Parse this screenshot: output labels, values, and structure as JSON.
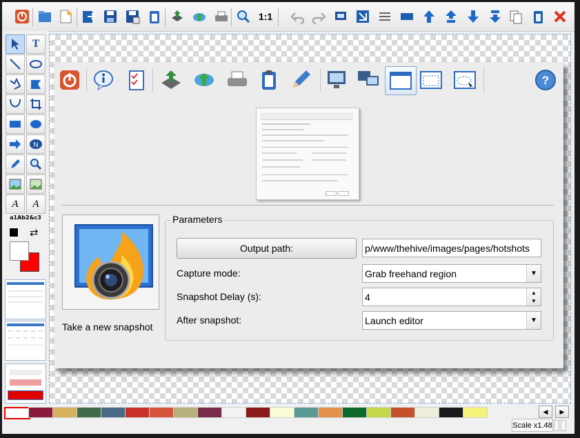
{
  "toolbar": {
    "icons": [
      "exit-icon",
      "open-icon",
      "new-icon",
      "export-icon",
      "save-icon",
      "save-as-icon",
      "clipboard-icon",
      "upload-icon",
      "cloud-upload-icon",
      "print-icon",
      "zoom-icon",
      "actual-size-icon",
      "undo-icon",
      "redo-icon",
      "capture-icon",
      "crop-icon",
      "align-icon",
      "rectangle-icon",
      "bring-to-front-icon",
      "move-up-icon",
      "move-down-icon",
      "send-to-back-icon",
      "copy-icon",
      "paste-icon",
      "close-icon"
    ],
    "actual_size_label": "1:1"
  },
  "tools": {
    "text_sample": "a1Ab2&c3",
    "colors": {
      "foreground": "#ffffff",
      "background": "#ff0000",
      "accent": "#3a78c8"
    }
  },
  "dialog": {
    "icons": [
      "exit-icon",
      "info-icon",
      "checklist-icon",
      "upload-icon",
      "cloud-upload-icon",
      "print-icon",
      "clipboard-icon",
      "pencil-icon",
      "monitor-icon",
      "dual-monitor-icon",
      "window-icon",
      "region-icon",
      "freehand-region-icon",
      "help-icon"
    ],
    "parameters_title": "Parameters",
    "snapshot_label": "Take a new snapshot",
    "output_path_button": "Output path:",
    "output_path_value": "p/www/thehive/images/pages/hotshots",
    "capture_mode_label": "Capture mode:",
    "capture_mode_value": "Grab freehand region",
    "delay_label": "Snapshot Delay (s):",
    "delay_value": "4",
    "after_label": "After snapshot:",
    "after_value": "Launch editor"
  },
  "palette": [
    "#ffffff",
    "#8b1a3a",
    "#d6b05a",
    "#3f6b4a",
    "#4a6a86",
    "#c8302a",
    "#d5543a",
    "#b6b07a",
    "#7a2a4a",
    "#f2f2f2",
    "#8b1a1a",
    "#fbfbd9",
    "#5a9a96",
    "#e2904a",
    "#0e6a2a",
    "#c6d64a",
    "#c4522a",
    "#eeeedd",
    "#1a1a1a",
    "#f5f27a"
  ],
  "status": {
    "scale": "Scale x1.48"
  }
}
